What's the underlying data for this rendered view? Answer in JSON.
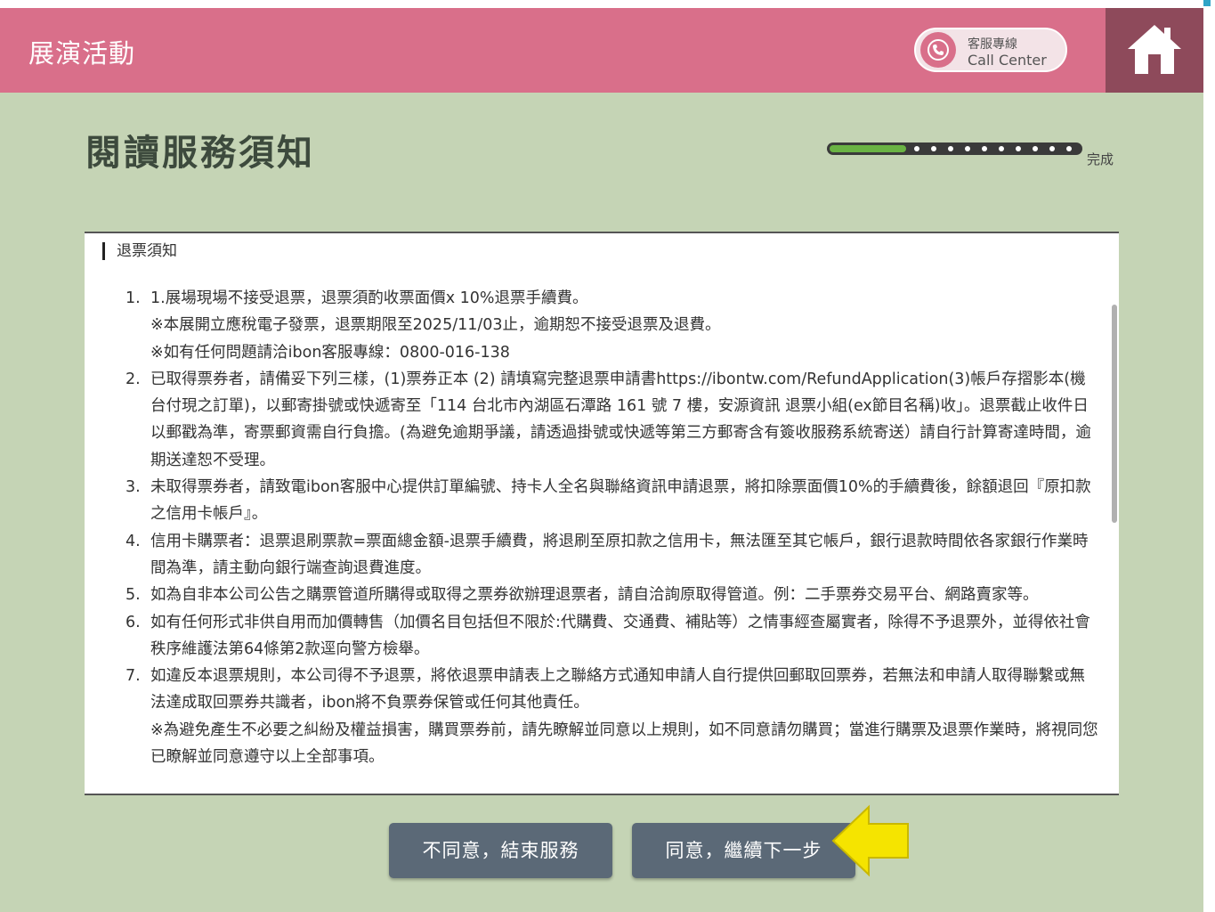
{
  "header": {
    "title": "展演活動",
    "call_center_line1": "客服專線",
    "call_center_line2": "Call Center"
  },
  "page": {
    "title": "閱讀服務須知",
    "progress_label": "完成",
    "progress_fraction": 0.3
  },
  "notice": {
    "heading": "退票須知",
    "items": [
      {
        "num": "1.",
        "lines": [
          "1.展場現場不接受退票，退票須酌收票面價x 10%退票手續費。",
          "※本展開立應稅電子發票，退票期限至2025/11/03止，逾期恕不接受退票及退費。",
          "※如有任何問題請洽ibon客服專線：0800-016-138"
        ]
      },
      {
        "num": "2.",
        "lines": [
          "已取得票券者，請備妥下列三樣，(1)票券正本 (2) 請填寫完整退票申請書https://ibontw.com/RefundApplication(3)帳戶存摺影本(機台付現之訂單)，以郵寄掛號或快遞寄至「114 台北市內湖區石潭路 161 號 7 樓，安源資訊 退票小組(ex節目名稱)收」。退票截止收件日以郵戳為準，寄票郵資需自行負擔。(為避免逾期爭議，請透過掛號或快遞等第三方郵寄含有簽收服務系統寄送）請自行計算寄達時間，逾期送達恕不受理。"
        ]
      },
      {
        "num": "3.",
        "lines": [
          "未取得票券者，請致電ibon客服中心提供訂單編號、持卡人全名與聯絡資訊申請退票，將扣除票面價10%的手續費後，餘額退回『原扣款之信用卡帳戶』。"
        ]
      },
      {
        "num": "4.",
        "lines": [
          "信用卡購票者：退票退刷票款=票面總金額-退票手續費，將退刷至原扣款之信用卡，無法匯至其它帳戶，銀行退款時間依各家銀行作業時間為準，請主動向銀行端查詢退費進度。"
        ]
      },
      {
        "num": "5.",
        "lines": [
          "如為自非本公司公告之購票管道所購得或取得之票券欲辦理退票者，請自洽詢原取得管道。例：二手票券交易平台、網路賣家等。"
        ]
      },
      {
        "num": "6.",
        "lines": [
          "如有任何形式非供自用而加價轉售（加價名目包括但不限於:代購費、交通費、補貼等）之情事經查屬實者，除得不予退票外，並得依社會秩序維護法第64條第2款逕向警方檢舉。"
        ]
      },
      {
        "num": "7.",
        "lines": [
          "如違反本退票規則，本公司得不予退票，將依退票申請表上之聯絡方式通知申請人自行提供回郵取回票券，若無法和申請人取得聯繫或無法達成取回票券共識者，ibon將不負票券保管或任何其他責任。",
          "※為避免產生不必要之糾紛及權益損害，購買票券前，請先瞭解並同意以上規則，如不同意請勿購買；當進行購票及退票作業時，將視同您已瞭解並同意遵守以上全部事項。"
        ]
      }
    ]
  },
  "buttons": {
    "disagree": "不同意，結束服務",
    "agree": "同意，繼續下一步"
  },
  "colors": {
    "header": "#d96f8a",
    "home": "#8e4a5b",
    "background": "#c5d4b5",
    "button": "#5b6977",
    "progress": "#6ab344",
    "arrow": "#f5e400"
  },
  "icons": {
    "call": "phone-icon",
    "home": "home-icon",
    "pointer": "arrow-left-icon"
  }
}
